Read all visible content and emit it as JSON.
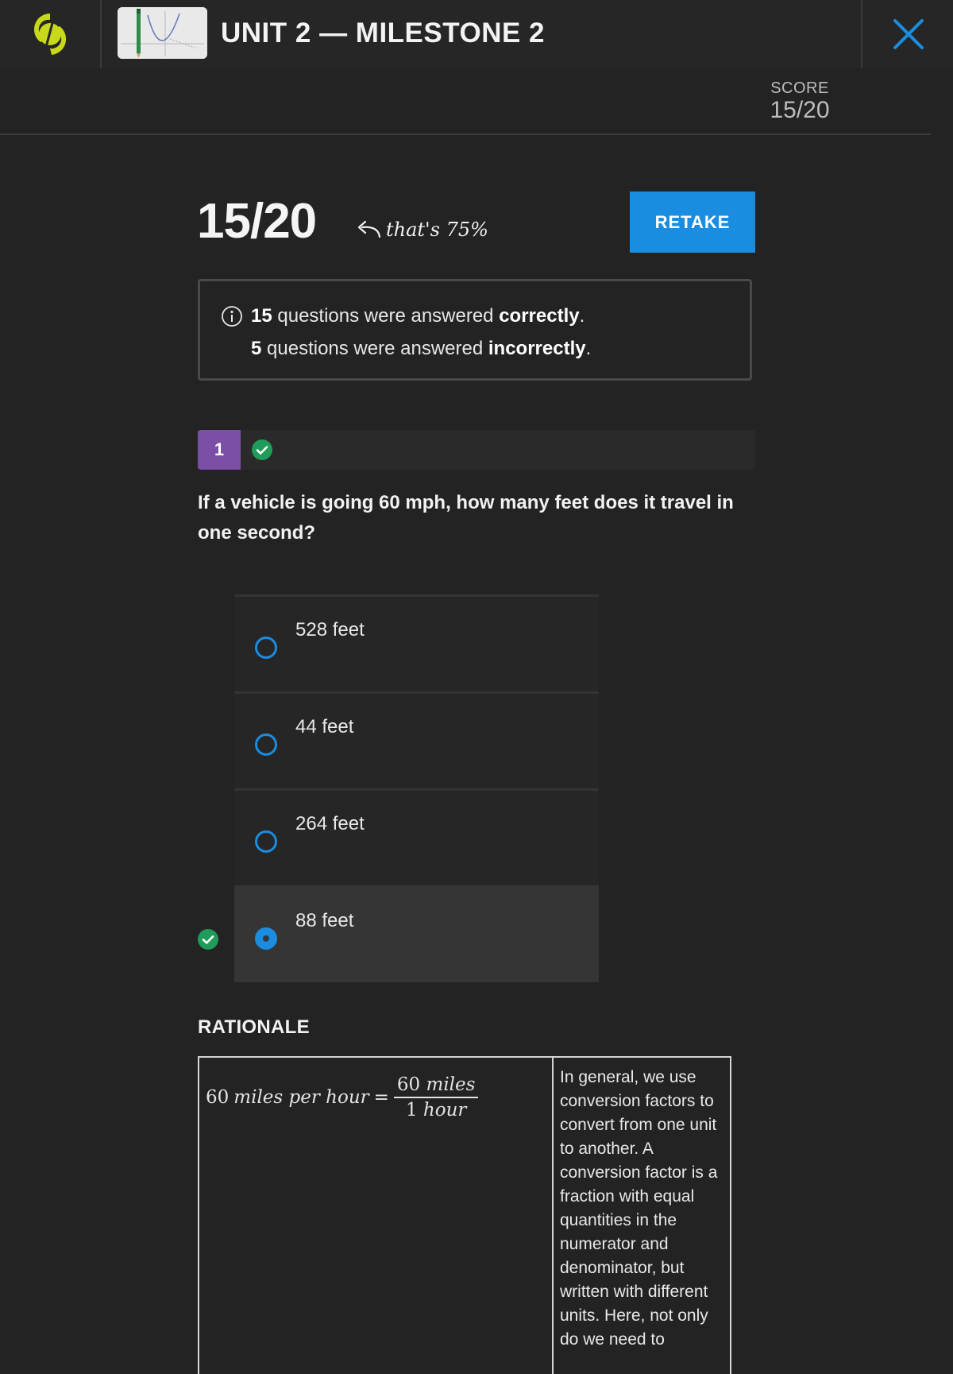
{
  "header": {
    "title": "UNIT 2 — MILESTONE 2",
    "logo_icon": "sophia-logo-icon",
    "thumbnail_icon": "graph-thumbnail-icon",
    "close_icon": "close-icon",
    "accent_color": "#1a8de0",
    "logo_color": "#c8d81a"
  },
  "score_panel": {
    "label": "SCORE",
    "value": "15/20"
  },
  "result": {
    "score": "15/20",
    "note": "that's 75%",
    "retake_label": "RETAKE"
  },
  "summary": {
    "correct_count": "15",
    "correct_text": " questions were answered ",
    "correct_word": "correctly",
    "correct_end": ".",
    "incorrect_count": "5",
    "incorrect_text": " questions were answered ",
    "incorrect_word": "incorrectly",
    "incorrect_end": "."
  },
  "question": {
    "number": "1",
    "status": "correct",
    "status_color": "#1f9c5a",
    "number_color": "#7b4fa6",
    "text": "If a vehicle is going 60 mph, how many feet does it travel in one second?",
    "answers": [
      {
        "label": "528 feet",
        "selected": false
      },
      {
        "label": "44 feet",
        "selected": false
      },
      {
        "label": "264 feet",
        "selected": false
      },
      {
        "label": "88 feet",
        "selected": true
      }
    ]
  },
  "rationale": {
    "title": "RATIONALE",
    "formula_lhs_num": "60",
    "formula_lhs_unit": "miles per hour",
    "formula_eq": "=",
    "formula_frac_num_value": "60",
    "formula_frac_num_unit": "miles",
    "formula_frac_den_value": "1",
    "formula_frac_den_unit": "hour",
    "explanation": "In general, we use conversion factors to convert from one unit to another. A conversion factor is a fraction with equal quantities in the numerator and denominator, but written with different units. Here, not only do we need to"
  }
}
